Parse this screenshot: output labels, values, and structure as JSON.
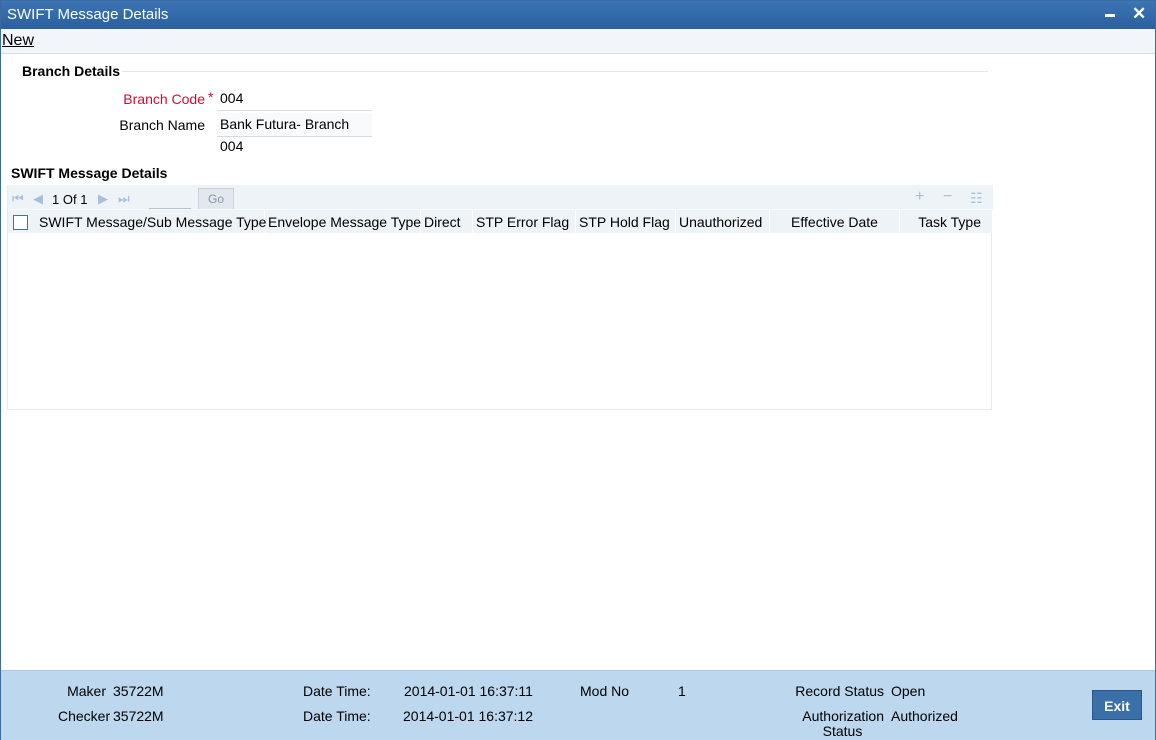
{
  "window": {
    "title": "SWIFT Message Details"
  },
  "menu": {
    "new_label": "New"
  },
  "branch_details": {
    "heading": "Branch Details",
    "branch_code_label": "Branch Code",
    "required_mark": "*",
    "branch_code_value": "004",
    "branch_name_label": "Branch Name",
    "branch_name_value": "Bank Futura- Branch 004"
  },
  "swift_details": {
    "heading": "SWIFT Message Details",
    "pagination": {
      "current": "1",
      "of_label": "Of",
      "total": "1"
    },
    "go_label": "Go",
    "columns": [
      "SWIFT Message/Sub Message Type",
      "Envelope Message Type",
      "Direct",
      "STP Error Flag",
      "STP Hold Flag",
      "Unauthorized",
      "Effective Date",
      "Task Type"
    ],
    "rows": []
  },
  "footer": {
    "maker_label": "Maker",
    "maker_value": "35722M",
    "checker_label": "Checker",
    "checker_value": "35722M",
    "date_time_label": "Date Time:",
    "maker_datetime": "2014-01-01 16:37:11",
    "checker_datetime": "2014-01-01 16:37:12",
    "mod_no_label": "Mod No",
    "mod_no_value": "1",
    "record_status_label": "Record Status",
    "record_status_value": "Open",
    "auth_status_label_1": "Authorization",
    "auth_status_label_2": "Status",
    "auth_status_value": "Authorized",
    "exit_label": "Exit"
  }
}
